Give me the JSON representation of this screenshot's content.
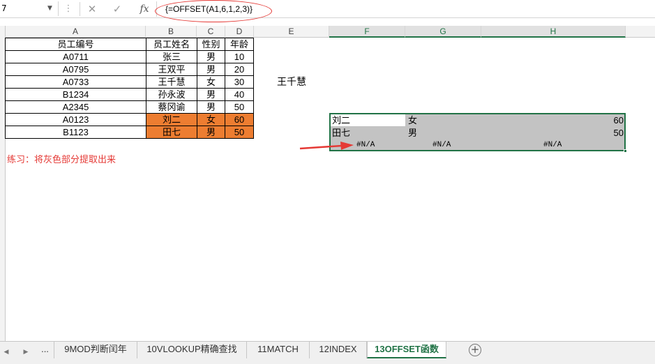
{
  "formula_bar": {
    "name_box": "7",
    "formula": "{=OFFSET(A1,6,1,2,3)}",
    "fx_label": "fx",
    "more_icon": "⋮",
    "cancel_icon": "✕",
    "confirm_icon": "✓"
  },
  "columns": [
    "A",
    "B",
    "C",
    "D",
    "E",
    "F",
    "G",
    "H"
  ],
  "table": {
    "headers": [
      "员工编号",
      "员工姓名",
      "性别",
      "年龄"
    ],
    "rows": [
      [
        "A0711",
        "张三",
        "男",
        "10"
      ],
      [
        "A0795",
        "王双平",
        "男",
        "20"
      ],
      [
        "A0733",
        "王千慧",
        "女",
        "30"
      ],
      [
        "B1234",
        "孙永波",
        "男",
        "40"
      ],
      [
        "A2345",
        "蔡冈谕",
        "男",
        "50"
      ],
      [
        "A0123",
        "刘二",
        "女",
        "60"
      ],
      [
        "B1123",
        "田七",
        "男",
        "50"
      ]
    ],
    "highlight_color": "#ed7d31"
  },
  "floating_text": "王千慧",
  "note": "练习：将灰色部分提取出来",
  "result": {
    "rows": [
      [
        "刘二",
        "女",
        "60"
      ],
      [
        "田七",
        "男",
        "50"
      ],
      [
        "#N/A",
        "#N/A",
        "#N/A"
      ]
    ],
    "fill_color": "#c3c3c3",
    "border_color": "#217346"
  },
  "sheet_tabs": {
    "ellipsis": "...",
    "tabs": [
      "9MOD判断闰年",
      "10VLOOKUP精确查找",
      "11MATCH",
      "12INDEX",
      "13OFFSET函数"
    ],
    "active_index": 4,
    "add_icon": "+"
  }
}
